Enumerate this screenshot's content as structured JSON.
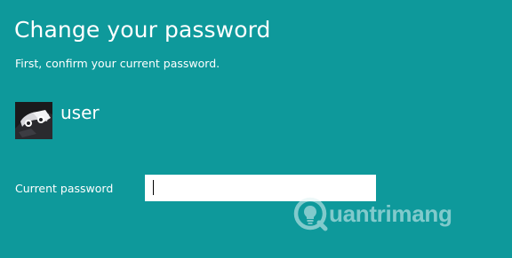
{
  "dialog": {
    "title": "Change your password",
    "subtitle": "First, confirm your current password."
  },
  "account": {
    "username": "user",
    "avatar_icon": "user-avatar-icon"
  },
  "form": {
    "current_password_label": "Current password",
    "current_password_value": "",
    "current_password_placeholder": ""
  },
  "watermark": {
    "text": "uantrimang",
    "logo_letter": "Q",
    "logo_icon": "lightbulb-icon"
  },
  "colors": {
    "background": "#0e999b",
    "text": "#ffffff",
    "input_background": "#ffffff"
  }
}
